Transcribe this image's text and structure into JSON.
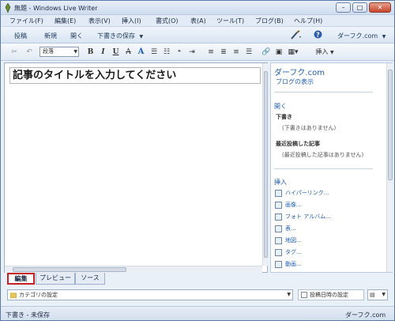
{
  "window": {
    "title": "無題 - Windows Live Writer"
  },
  "menu": [
    "ファイル(F)",
    "編集(E)",
    "表示(V)",
    "挿入(I)",
    "書式(O)",
    "表(A)",
    "ツール(T)",
    "ブログ(B)",
    "ヘルプ(H)"
  ],
  "command_bar": {
    "post": "投稿",
    "new": "新規",
    "open": "開く",
    "save_draft": "下書きの保存",
    "blog_name": "ダーフク.com"
  },
  "format_bar": {
    "paragraph_style": "段落",
    "bold": "B",
    "italic": "I",
    "underline": "U",
    "strikethrough": "A",
    "font_color": "A",
    "insert": "挿入"
  },
  "editor": {
    "title_placeholder": "記事のタイトルを入力してください"
  },
  "sidebar": {
    "blog_name": "ダーフク.com",
    "view_blog": "ブログの表示",
    "open_heading": "開く",
    "drafts_heading": "下書き",
    "no_drafts": "(下書きはありません)",
    "recent_heading": "最近投稿した記事",
    "no_recent": "(最近投稿した記事はありません)",
    "insert_heading": "挿入",
    "insert_items": [
      "ハイパーリンク...",
      "画像...",
      "フォト アルバム...",
      "表...",
      "地図...",
      "タグ...",
      "動画..."
    ]
  },
  "tabs": [
    "編集",
    "プレビュー",
    "ソース"
  ],
  "properties": {
    "category": "カテゴリの設定",
    "publish_date": "投稿日時の設定"
  },
  "status": {
    "left": "下書き - 未保存",
    "right": "ダーフク.com"
  },
  "colors": {
    "accent_link": "#1f5fb4",
    "active_tab_border": "#c62127",
    "chrome": "#dce7f4"
  }
}
